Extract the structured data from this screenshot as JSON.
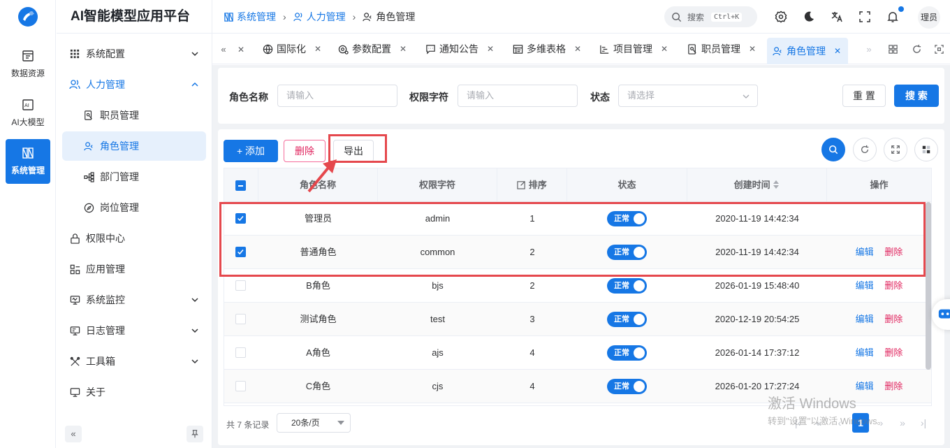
{
  "rail": {
    "items": [
      {
        "label": "数据资源"
      },
      {
        "label": "AI大模型"
      },
      {
        "label": "系统管理"
      }
    ]
  },
  "side": {
    "brand": "AI智能模型应用平台",
    "items": [
      {
        "label": "系统配置"
      },
      {
        "label": "人力管理"
      },
      {
        "label": "职员管理"
      },
      {
        "label": "角色管理"
      },
      {
        "label": "部门管理"
      },
      {
        "label": "岗位管理"
      },
      {
        "label": "权限中心"
      },
      {
        "label": "应用管理"
      },
      {
        "label": "系统监控"
      },
      {
        "label": "日志管理"
      },
      {
        "label": "工具箱"
      },
      {
        "label": "关于"
      }
    ]
  },
  "header": {
    "breadcrumb": [
      "系统管理",
      "人力管理",
      "角色管理"
    ],
    "search_placeholder": "搜索",
    "search_shortcut": "Ctrl+K",
    "avatar_text": "理员"
  },
  "tabs": [
    {
      "label": "国际化"
    },
    {
      "label": "参数配置"
    },
    {
      "label": "通知公告"
    },
    {
      "label": "多维表格"
    },
    {
      "label": "项目管理"
    },
    {
      "label": "职员管理"
    },
    {
      "label": "角色管理"
    }
  ],
  "filter": {
    "role_name_label": "角色名称",
    "role_name_placeholder": "请输入",
    "perm_label": "权限字符",
    "perm_placeholder": "请输入",
    "status_label": "状态",
    "status_placeholder": "请选择",
    "reset_label": "重 置",
    "search_label": "搜 索"
  },
  "toolbar": {
    "add_label": "+ 添加",
    "delete_label": "删除",
    "export_label": "导出"
  },
  "table": {
    "headers": {
      "name": "角色名称",
      "perm": "权限字符",
      "sort": "排序",
      "status": "状态",
      "created": "创建时间",
      "ops": "操作"
    },
    "rows": [
      {
        "name": "管理员",
        "perm": "admin",
        "sort": "1",
        "status": "正常",
        "created": "2020-11-19 14:42:34",
        "checked": true
      },
      {
        "name": "普通角色",
        "perm": "common",
        "sort": "2",
        "status": "正常",
        "created": "2020-11-19 14:42:34",
        "checked": true,
        "edit": "编辑",
        "del": "删除"
      },
      {
        "name": "B角色",
        "perm": "bjs",
        "sort": "2",
        "status": "正常",
        "created": "2026-01-19 15:48:40",
        "checked": false,
        "edit": "编辑",
        "del": "删除"
      },
      {
        "name": "测试角色",
        "perm": "test",
        "sort": "3",
        "status": "正常",
        "created": "2020-12-19 20:54:25",
        "checked": false,
        "edit": "编辑",
        "del": "删除"
      },
      {
        "name": "A角色",
        "perm": "ajs",
        "sort": "4",
        "status": "正常",
        "created": "2026-01-14 17:37:12",
        "checked": false,
        "edit": "编辑",
        "del": "删除"
      },
      {
        "name": "C角色",
        "perm": "cjs",
        "sort": "4",
        "status": "正常",
        "created": "2026-01-20 17:27:24",
        "checked": false,
        "edit": "编辑",
        "del": "删除"
      }
    ]
  },
  "pager": {
    "total": "共 7 条记录",
    "page_size": "20条/页",
    "current": "1"
  },
  "watermark": {
    "line1": "激活 Windows",
    "line2": "转到\"设置\"以激活 Windows。"
  },
  "colors": {
    "accent": "#1677e5",
    "danger": "#e0245e",
    "annotation": "#e5484d"
  }
}
